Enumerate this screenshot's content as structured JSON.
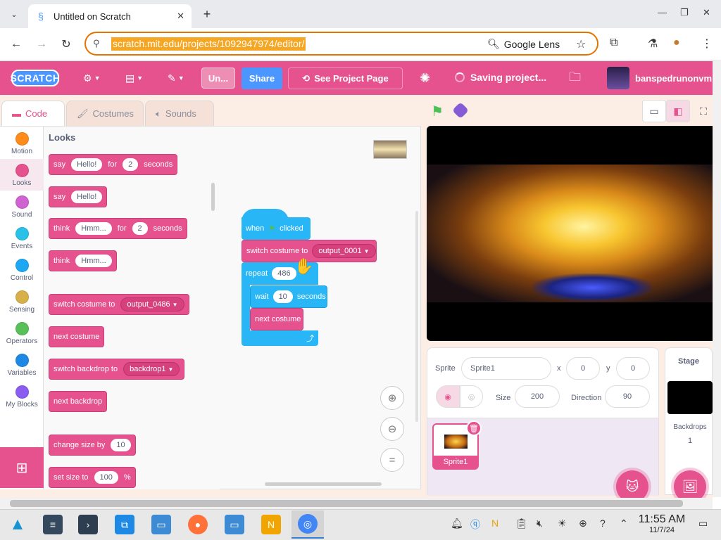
{
  "browser": {
    "tab_title": "Untitled on Scratch",
    "url": "scratch.mit.edu/projects/1092947974/editor/",
    "lens_label": "Google Lens"
  },
  "menu": {
    "logo": "SCRATCH",
    "project_title": "Un...",
    "share": "Share",
    "see_project_page": "See Project Page",
    "saving": "Saving project...",
    "username": "banspedrunonvm"
  },
  "editor_tabs": {
    "code": "Code",
    "costumes": "Costumes",
    "sounds": "Sounds"
  },
  "categories": [
    {
      "label": "Motion",
      "color": "#4c97ff"
    },
    {
      "label": "Looks",
      "color": "#9966ff"
    },
    {
      "label": "Sound",
      "color": "#cf63cf"
    },
    {
      "label": "Events",
      "color": "#ffbf00"
    },
    {
      "label": "Control",
      "color": "#ffab19"
    },
    {
      "label": "Sensing",
      "color": "#5cb1d6"
    },
    {
      "label": "Operators",
      "color": "#59c059"
    },
    {
      "label": "Variables",
      "color": "#ff8c1a"
    },
    {
      "label": "My Blocks",
      "color": "#ff6680"
    }
  ],
  "palette": {
    "title": "Looks",
    "blocks": {
      "say_for": {
        "w1": "say",
        "v1": "Hello!",
        "w2": "for",
        "v2": "2",
        "w3": "seconds"
      },
      "say": {
        "w1": "say",
        "v1": "Hello!"
      },
      "think_for": {
        "w1": "think",
        "v1": "Hmm...",
        "w2": "for",
        "v2": "2",
        "w3": "seconds"
      },
      "think": {
        "w1": "think",
        "v1": "Hmm..."
      },
      "switch_costume": {
        "w1": "switch costume to",
        "v1": "output_0486"
      },
      "next_costume": {
        "w1": "next costume"
      },
      "switch_backdrop": {
        "w1": "switch backdrop to",
        "v1": "backdrop1"
      },
      "next_backdrop": {
        "w1": "next backdrop"
      },
      "change_size": {
        "w1": "change size by",
        "v1": "10"
      },
      "set_size": {
        "w1": "set size to",
        "v1": "100",
        "w2": "%"
      }
    }
  },
  "script": {
    "when_clicked": {
      "w1": "when",
      "w2": "clicked"
    },
    "switch_costume": {
      "w1": "switch costume to",
      "v1": "output_0001"
    },
    "repeat": {
      "w1": "repeat",
      "v1": "486"
    },
    "wait": {
      "w1": "wait",
      "v1": "10",
      "w2": "seconds"
    },
    "next_costume": {
      "w1": "next costume"
    }
  },
  "sprite_info": {
    "sprite_label": "Sprite",
    "sprite_name": "Sprite1",
    "x_label": "x",
    "x": "0",
    "y_label": "y",
    "y": "0",
    "show_label": "Show",
    "size_label": "Size",
    "size": "200",
    "direction_label": "Direction",
    "direction": "90"
  },
  "sprites": [
    {
      "name": "Sprite1"
    }
  ],
  "stage_panel": {
    "title": "Stage",
    "backdrops_label": "Backdrops",
    "backdrops_count": "1"
  },
  "taskbar": {
    "time": "11:55 AM",
    "date": "11/7/24"
  },
  "colors": {
    "scratch_pink": "#e6528e",
    "looks_pink": "#e6528e",
    "control": "#4cb4ff",
    "share_blue": "#4c97ff",
    "url_highlight": "#f5a623"
  }
}
